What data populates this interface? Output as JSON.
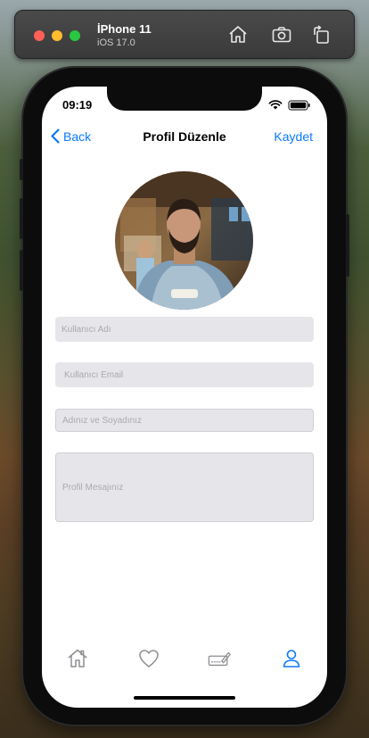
{
  "simulator": {
    "device_name": "İPhone 11",
    "os_version": "iOS 17.0",
    "icons": [
      "home-icon",
      "screenshot-icon",
      "rotate-icon"
    ]
  },
  "status_bar": {
    "time": "09:19",
    "icons": [
      "wifi-icon",
      "battery-icon"
    ]
  },
  "nav": {
    "back_label": "Back",
    "title": "Profil Düzenle",
    "save_label": "Kaydet"
  },
  "form": {
    "username_placeholder": "Kullanıcı Adı",
    "email_placeholder": "Kullanıcı Email",
    "fullname_placeholder": "Adınız ve Soyadınız",
    "message_placeholder": "Profil Mesajınız"
  },
  "tab_bar": {
    "items": [
      {
        "icon": "home-icon",
        "active": false
      },
      {
        "icon": "heart-icon",
        "active": false
      },
      {
        "icon": "signature-icon",
        "active": false
      },
      {
        "icon": "person-icon",
        "active": true
      }
    ]
  },
  "colors": {
    "accent": "#0a7aff",
    "field_bg": "#e6e6ea",
    "placeholder": "#a9a9ae"
  }
}
